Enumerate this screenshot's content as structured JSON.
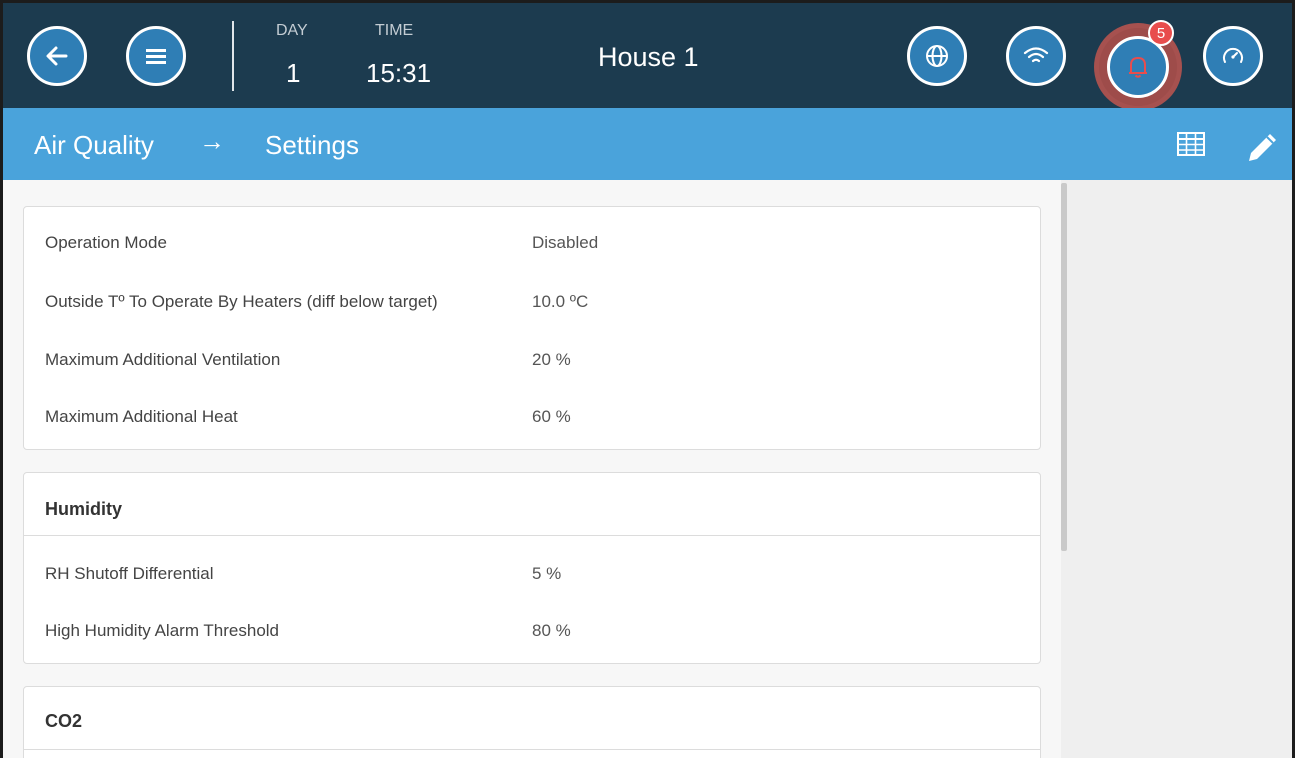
{
  "header": {
    "day_label": "DAY",
    "day_value": "1",
    "time_label": "TIME",
    "time_value": "15:31",
    "title": "House 1",
    "alarm_count": "5",
    "icons": [
      "back-arrow-icon",
      "menu-icon",
      "globe-icon",
      "wifi-icon",
      "bell-icon",
      "gauge-icon"
    ]
  },
  "breadcrumb": {
    "section": "Air Quality",
    "arrow": "→",
    "page": "Settings",
    "icons": [
      "table-icon",
      "pencil-icon"
    ]
  },
  "general": {
    "rows": [
      {
        "label": "Operation Mode",
        "value": "Disabled"
      },
      {
        "label": "Outside Tº To Operate By Heaters (diff below target)",
        "value": "10.0 ºC"
      },
      {
        "label": "Maximum Additional Ventilation",
        "value": "20 %"
      },
      {
        "label": "Maximum Additional Heat",
        "value": "60 %"
      }
    ]
  },
  "humidity": {
    "title": "Humidity",
    "rows": [
      {
        "label": "RH Shutoff Differential",
        "value": "5 %"
      },
      {
        "label": "High Humidity Alarm Threshold",
        "value": "80 %"
      }
    ]
  },
  "co2": {
    "title": "CO2"
  },
  "colors": {
    "topbar": "#1c3b4f",
    "subbar": "#4aa3db",
    "button": "#2f7eb5",
    "badge": "#e84d4d"
  }
}
